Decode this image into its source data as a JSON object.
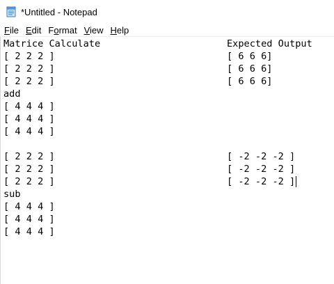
{
  "window": {
    "title": "*Untitled - Notepad"
  },
  "menu": [
    {
      "underline": "F",
      "rest": "ile"
    },
    {
      "underline": "E",
      "rest": "dit"
    },
    {
      "underline": "F",
      "rest": "ormat",
      "prefix": "F",
      "u2": "o",
      "rest2": "rmat"
    },
    {
      "underline": "V",
      "rest": "iew"
    },
    {
      "underline": "H",
      "rest": "elp"
    }
  ],
  "menu_labels": {
    "file_u": "F",
    "file_r": "ile",
    "edit_u": "E",
    "edit_r": "dit",
    "format_a": "F",
    "format_u": "o",
    "format_r": "rmat",
    "view_u": "V",
    "view_r": "iew",
    "help_u": "H",
    "help_r": "elp"
  },
  "document": {
    "left_lines": [
      "Matrice Calculate",
      "[ 2 2 2 ]",
      "[ 2 2 2 ]",
      "[ 2 2 2 ]",
      "add",
      "[ 4 4 4 ]",
      "[ 4 4 4 ]",
      "[ 4 4 4 ]",
      "",
      "[ 2 2 2 ]",
      "[ 2 2 2 ]",
      "[ 2 2 2 ]",
      "sub",
      "[ 4 4 4 ]",
      "[ 4 4 4 ]",
      "[ 4 4 4 ]"
    ],
    "right_lines": [
      "Expected Output",
      "[ 6 6 6]",
      "[ 6 6 6]",
      "[ 6 6 6]",
      "",
      "",
      "",
      "",
      "",
      "[ -2 -2 -2 ]",
      "[ -2 -2 -2 ]",
      "[ -2 -2 -2 ]",
      "",
      "",
      "",
      ""
    ],
    "caret_line": 11
  },
  "icons": {
    "app": "notepad-icon"
  }
}
